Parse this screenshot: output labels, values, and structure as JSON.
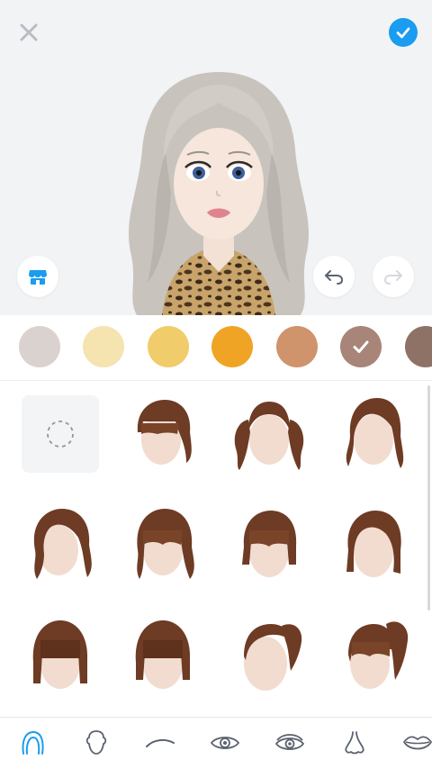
{
  "header": {
    "close_icon": "close-icon",
    "confirm_icon": "check-circle-icon"
  },
  "preview": {
    "store_icon": "store-icon",
    "undo_icon": "undo-icon",
    "redo_icon": "redo-icon",
    "avatar_hair_color": "#c9c6c0",
    "avatar_shirt": "leopard-print"
  },
  "swatches": {
    "colors": [
      "#d9d2ce",
      "#f5e3b0",
      "#f1cc6a",
      "#f0a425",
      "#cf946b",
      "#a88579",
      "#8f7266"
    ],
    "selected_index": 5
  },
  "hair_grid": {
    "none_option": "empty-dashed-circle-icon",
    "styles": [
      "short-bob-bangs",
      "twin-ponytails",
      "side-part-medium",
      "side-part-wavy",
      "wavy-bangs",
      "straight-bob-bangs",
      "side-part-bob",
      "bob-blunt-bangs",
      "bob-blunt-bangs-short",
      "high-ponytail-side",
      "high-ponytail-bangs"
    ],
    "hair_color": "#6e3b24"
  },
  "tabs": {
    "items": [
      "hair-icon",
      "face-shape-icon",
      "eyebrow-icon",
      "eye-icon",
      "eye-detail-icon",
      "nose-icon",
      "lips-icon"
    ],
    "active_index": 0,
    "active_color": "#1a9cf0"
  }
}
